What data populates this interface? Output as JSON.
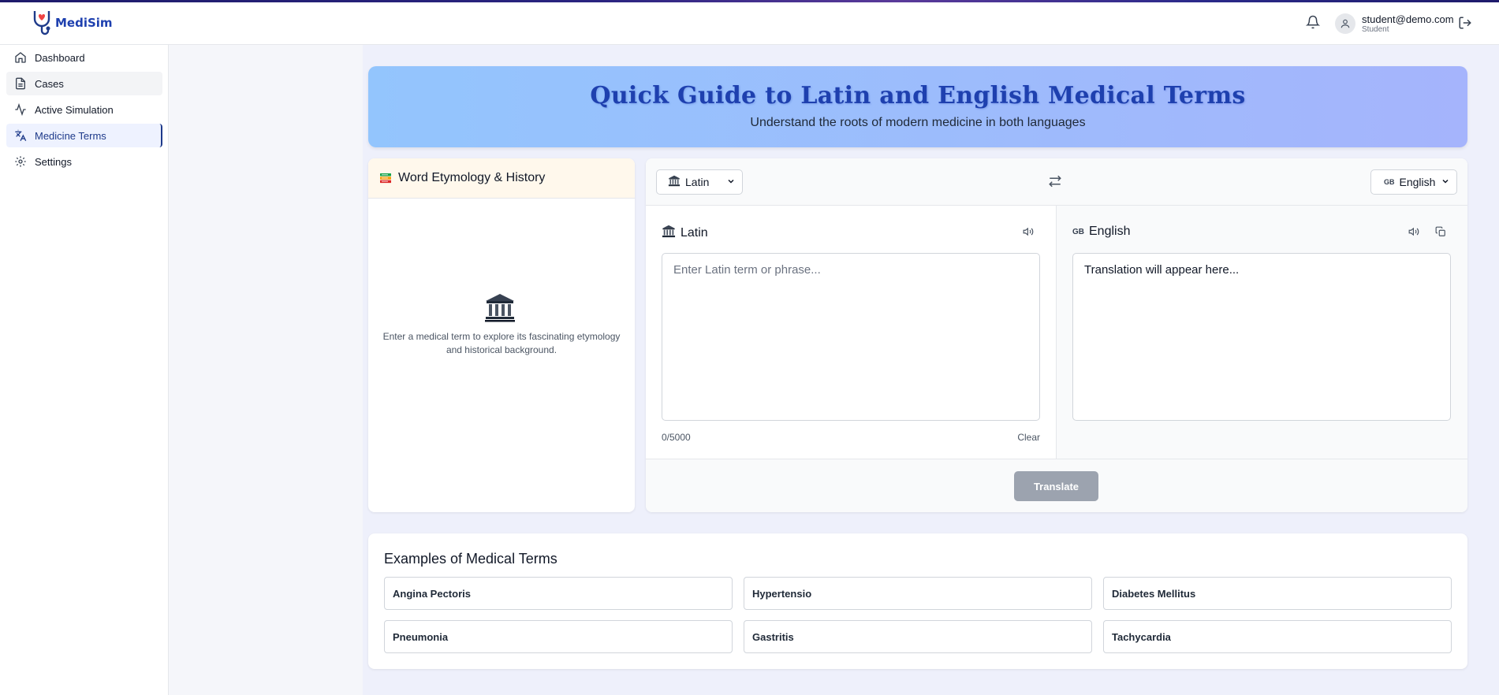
{
  "app": {
    "name": "MediSim"
  },
  "header": {
    "user_email": "student@demo.com",
    "user_role": "Student"
  },
  "sidebar": {
    "items": [
      {
        "label": "Dashboard",
        "icon": "home-icon"
      },
      {
        "label": "Cases",
        "icon": "document-icon"
      },
      {
        "label": "Active Simulation",
        "icon": "activity-icon"
      },
      {
        "label": "Medicine Terms",
        "icon": "translate-icon",
        "active": true
      },
      {
        "label": "Settings",
        "icon": "gear-icon"
      }
    ]
  },
  "hero": {
    "title": "Quick Guide to Latin and English Medical Terms",
    "subtitle": "Understand the roots of modern medicine in both languages"
  },
  "etymology": {
    "title": "Word Etymology & History",
    "empty_text": "Enter a medical term to explore its fascinating etymology and historical background."
  },
  "translator": {
    "source_select": "Latin",
    "target_select": "English",
    "target_flag": "GB",
    "source_label": "Latin",
    "target_label": "English",
    "input_placeholder": "Enter Latin term or phrase...",
    "output_placeholder": "Translation will appear here...",
    "char_count": "0/5000",
    "clear_label": "Clear",
    "translate_label": "Translate"
  },
  "examples": {
    "title": "Examples of Medical Terms",
    "items": [
      "Angina Pectoris",
      "Hypertensio",
      "Diabetes Mellitus",
      "Pneumonia",
      "Gastritis",
      "Tachycardia"
    ]
  },
  "colors": {
    "brand": "#1e40af",
    "hero_gradient_start": "#93c5fd",
    "hero_gradient_end": "#a5b4fc",
    "translate_button_disabled": "#9ca3af",
    "etymology_header_bg": "#fff8ec"
  }
}
